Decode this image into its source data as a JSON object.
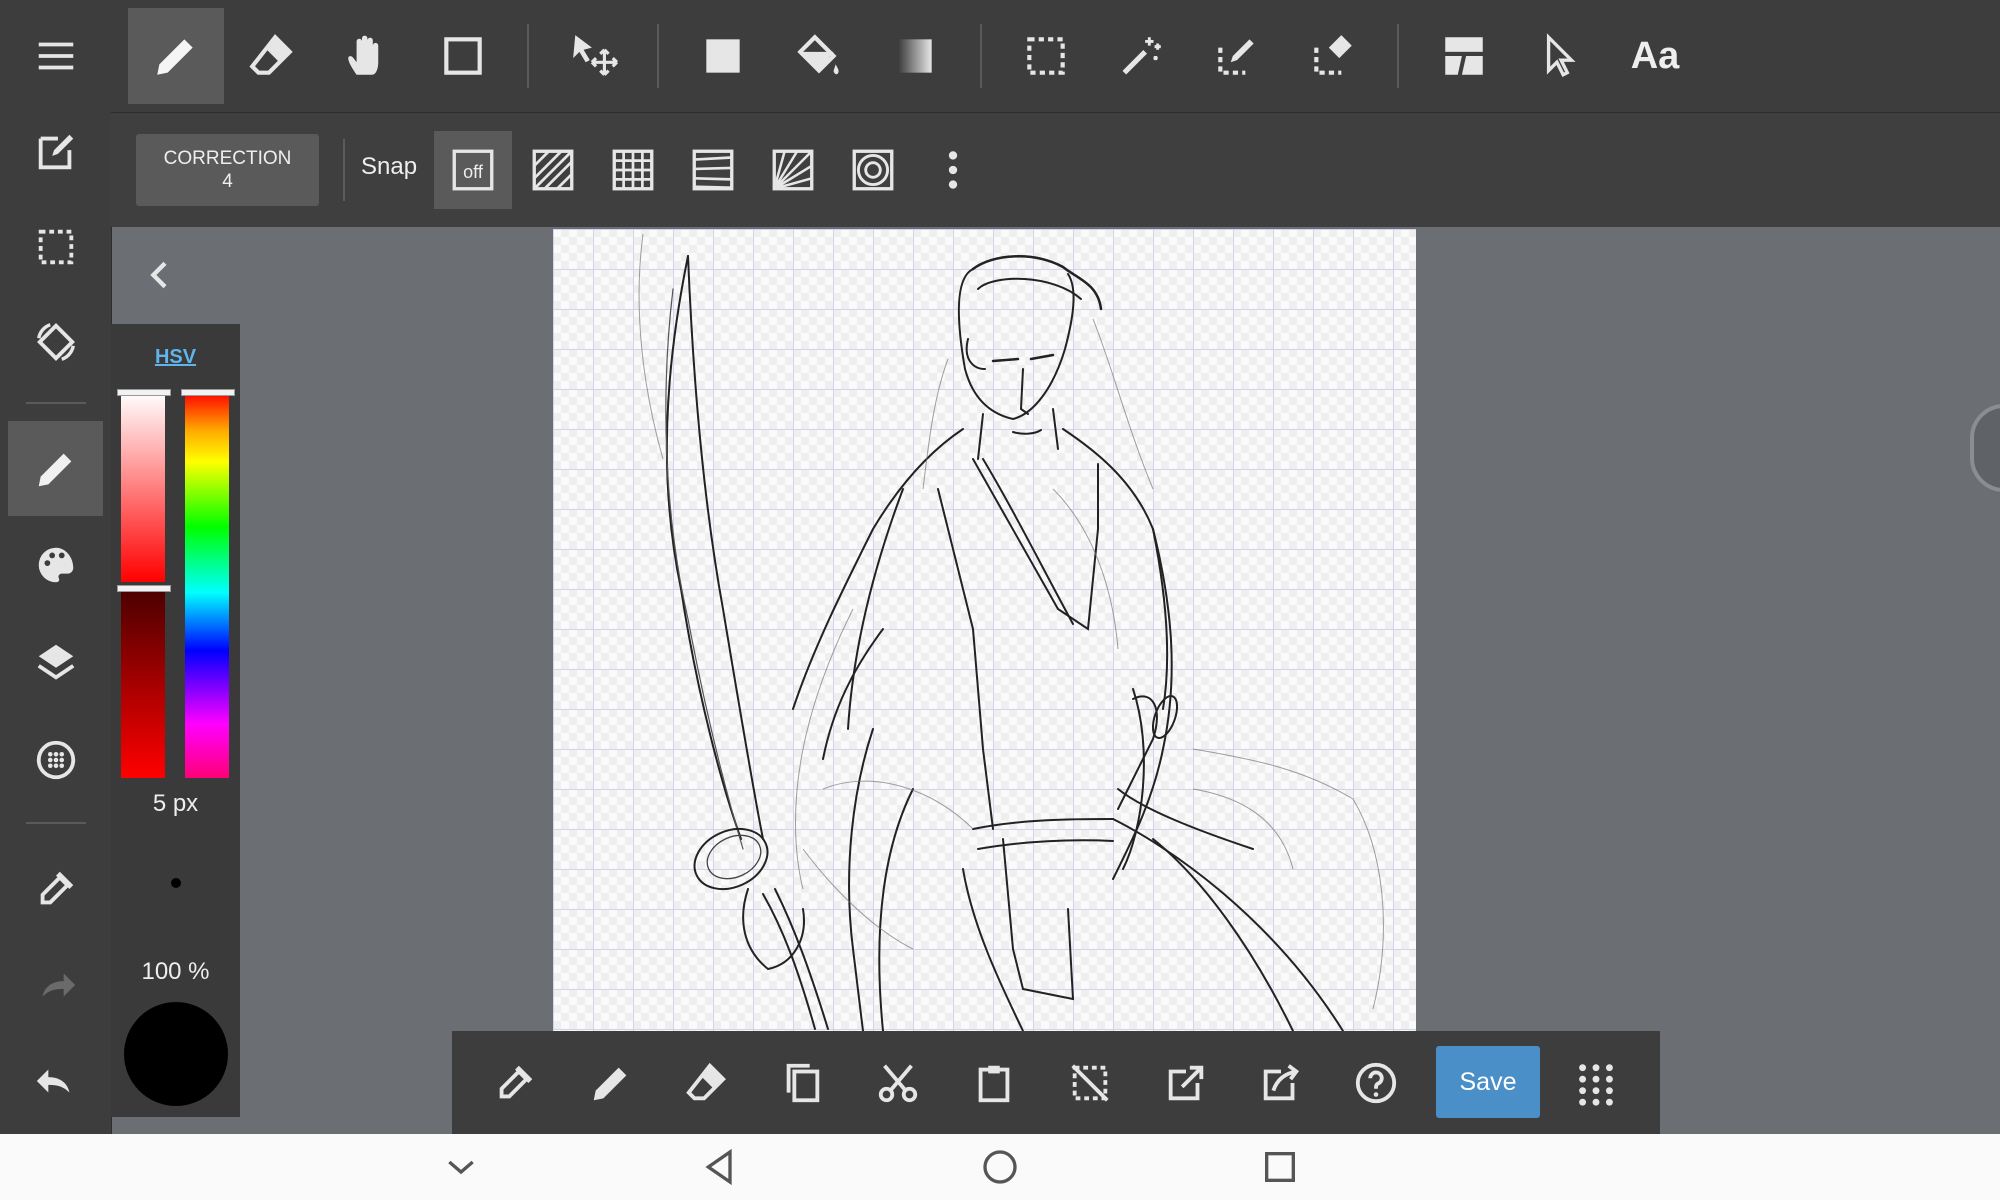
{
  "sidebar": {
    "items": [
      {
        "icon": "menu-icon"
      },
      {
        "icon": "edit-canvas-icon"
      },
      {
        "icon": "selection-icon"
      },
      {
        "icon": "rotate-icon"
      },
      {
        "icon": "pen-icon",
        "active": true
      },
      {
        "icon": "palette-icon"
      },
      {
        "icon": "layers-icon"
      },
      {
        "icon": "brush-settings-icon"
      },
      {
        "icon": "eyedropper-icon"
      },
      {
        "icon": "redo-icon",
        "disabled": true
      },
      {
        "icon": "undo-icon"
      }
    ]
  },
  "toolbar": {
    "tools": [
      {
        "icon": "pen-icon",
        "active": true
      },
      {
        "icon": "eraser-icon"
      },
      {
        "icon": "hand-icon"
      },
      {
        "icon": "shape-icon"
      },
      {
        "icon": "move-icon"
      },
      {
        "icon": "fill-rect-icon"
      },
      {
        "icon": "bucket-icon"
      },
      {
        "icon": "gradient-icon"
      },
      {
        "icon": "select-rect-icon"
      },
      {
        "icon": "magic-wand-icon"
      },
      {
        "icon": "select-pen-icon"
      },
      {
        "icon": "select-eraser-icon"
      },
      {
        "icon": "frame-divider-icon"
      },
      {
        "icon": "pointer-icon"
      }
    ],
    "text_tool_label": "Aa"
  },
  "subbar": {
    "correction_label": "CORRECTION",
    "correction_value": "4",
    "snap_label": "Snap",
    "snap_off_label": "off"
  },
  "color_panel": {
    "mode_label": "HSV",
    "brush_size": "5 px",
    "opacity": "100 %",
    "color": "#000000",
    "saturation_level": 0.0,
    "value_level": 1.0,
    "hue_level": 0.0
  },
  "bottom_bar": {
    "save_label": "Save"
  },
  "colors": {
    "accent": "#4a8fc7",
    "link": "#5fb4ea",
    "toolbar_bg": "#3d3d3d",
    "workspace_bg": "#6b6e73"
  }
}
